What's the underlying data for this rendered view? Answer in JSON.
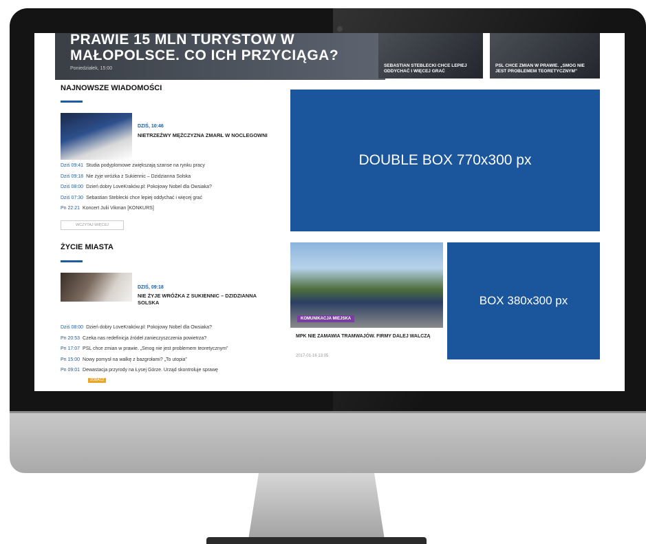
{
  "hero": {
    "title": "PRAWIE 15 MLN TURYSTÓW W MAŁOPOLSCE. CO ICH PRZYCIĄGA?",
    "date": "Poniedziałek, 15:00"
  },
  "tiles": [
    {
      "title": "SEBASTIAN STEBLECKI CHCE LEPIEJ ODDYCHAĆ I WIĘCEJ GRAĆ"
    },
    {
      "title": "PSL CHCE ZMIAN W PRAWIE. „SMOG NIE JEST PROBLEMEM TEORETYCZNYM”"
    }
  ],
  "latest": {
    "heading": "NAJNOWSZE WIADOMOŚCI",
    "featured_time": "DZIŚ, 10:46",
    "featured_title": "NIETRZEŹWY MĘŻCZYZNA ZMARŁ W NOCLEGOWNI",
    "items": [
      {
        "time": "Dziś 09:41",
        "text": "Studia podyplomowe zwiększają szanse na rynku pracy"
      },
      {
        "time": "Dziś 09:18",
        "text": "Nie żyje wróżka z Sukiennic – Dzidzianna Solska"
      },
      {
        "time": "Dziś 08:00",
        "text": "Dzień dobry LoveKraków.pl: Pokojowy Nobel dla Owsiaka?"
      },
      {
        "time": "Dziś 07:30",
        "text": "Sebastian Steblecki chce lepiej oddychać i więcej grać"
      },
      {
        "time": "Pn 22:21",
        "text": "Koncert Julii Vikman [KONKURS]"
      }
    ],
    "more_label": "WCZYTAJ WIĘCEJ"
  },
  "city": {
    "heading": "ŻYCIE MIASTA",
    "featured_time": "DZIŚ, 09:18",
    "featured_title": "NIE ŻYJE WRÓŻKA Z SUKIENNIC – DZIDZIANNA SOLSKA",
    "items": [
      {
        "time": "Dziś 08:00",
        "text": "Dzień dobry LoveKraków.pl: Pokojowy Nobel dla Owsiaka?"
      },
      {
        "time": "Pn 20:53",
        "text": "Czeka nas redefinicja źródeł zanieczyszczenia powietrza?"
      },
      {
        "time": "Pn 17:07",
        "text": "PSL chce zmian w prawie. „Smog nie jest problemem teoretycznym”"
      },
      {
        "time": "Pn 15:00",
        "text": "Nowy pomysł na walkę z bazgrołami? „To utopia”"
      },
      {
        "time": "Pn 09:01",
        "text": "Dewastacja przyrody na Łysej Górze. Urząd skontroluje sprawę"
      }
    ],
    "badge": "ZOBACZ"
  },
  "ads": {
    "double_box": "DOUBLE BOX 770x300 px",
    "box": "BOX 380x300 px"
  },
  "photo_article": {
    "badge": "KOMUNIKACJA MIEJSKA",
    "title": "MPK NIE ZAMAWIA TRAMWAJÓW. FIRMY DALEJ WALCZĄ",
    "date": "2017-01-16 13:05"
  }
}
